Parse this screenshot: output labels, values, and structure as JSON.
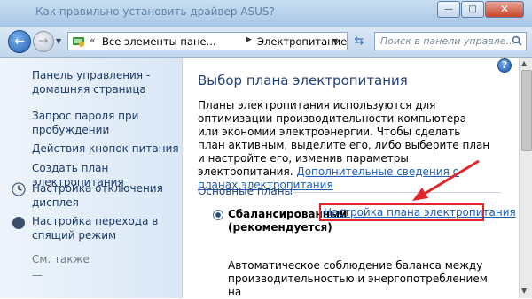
{
  "window": {
    "ghost_title": "Как правильно установить драйвер ASUS?",
    "minimize": "—",
    "maximize": "□",
    "close": "✕"
  },
  "nav": {
    "back_icon": "arrow-left",
    "forward_icon": "arrow-right",
    "address": {
      "chevron": "«",
      "crumb1": "Все элементы пане...",
      "arrow": "▶",
      "crumb2": "Электропитание"
    },
    "search_placeholder": "Поиск в панели управле...",
    "refresh_icon": "⇆"
  },
  "sidebar": {
    "home_link": "Панель управления - домашняя страница",
    "items": [
      {
        "label": "Запрос пароля при пробуждении"
      },
      {
        "label": "Действия кнопок питания"
      },
      {
        "label": "Создать план электропитания"
      },
      {
        "label": "Настройка отключения дисплея"
      },
      {
        "label": "Настройка перехода в спящий режим"
      }
    ],
    "see_also": "См. также",
    "extra": "—"
  },
  "main": {
    "help": "?",
    "title": "Выбор плана электропитания",
    "description": "Планы электропитания используются для оптимизации производительности компьютера или экономии электроэнергии. Чтобы сделать план активным, выделите его, либо выберите план и настройте его, изменив параметры электропитания.",
    "more_info_link": "Дополнительные сведения о планах электропитания",
    "section_title": "Основные планы",
    "plan": {
      "name": "Сбалансированный (рекомендуется)",
      "settings_link": "Настройка плана электропитания",
      "description": "Автоматическое соблюдение баланса между производительностью и энергопотреблением на"
    }
  },
  "colors": {
    "highlight_box": "#e0262a",
    "link": "#1f5fb3",
    "heading": "#1f3f77"
  }
}
